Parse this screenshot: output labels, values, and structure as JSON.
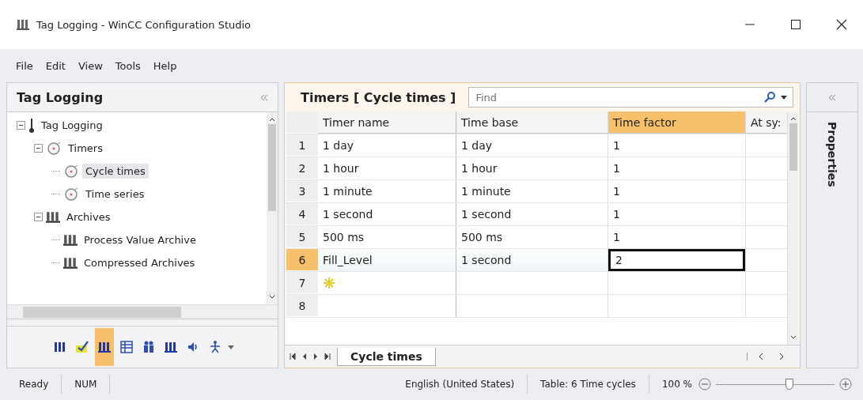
{
  "window": {
    "title": "Tag Logging - WinCC Configuration Studio"
  },
  "menu": [
    {
      "label": "File"
    },
    {
      "label": "Edit"
    },
    {
      "label": "View"
    },
    {
      "label": "Tools"
    },
    {
      "label": "Help"
    }
  ],
  "navigation": {
    "title": "Tag Logging",
    "tree": [
      {
        "label": "Tag Logging",
        "kind": "root",
        "expanded": true,
        "selected": false,
        "children": [
          {
            "label": "Timers",
            "kind": "timer",
            "expanded": true,
            "selected": false,
            "children": [
              {
                "label": "Cycle times",
                "kind": "timer",
                "selected": true
              },
              {
                "label": "Time series",
                "kind": "timer",
                "selected": false
              }
            ]
          },
          {
            "label": "Archives",
            "kind": "archive",
            "expanded": true,
            "selected": false,
            "children": [
              {
                "label": "Process Value Archive",
                "kind": "archive",
                "selected": false
              },
              {
                "label": "Compressed Archives",
                "kind": "archive",
                "selected": false
              }
            ]
          }
        ]
      }
    ],
    "toolbar": [
      {
        "kind": "bars",
        "selected": false
      },
      {
        "kind": "check",
        "selected": false
      },
      {
        "kind": "archive",
        "selected": true
      },
      {
        "kind": "table",
        "selected": false
      },
      {
        "kind": "people",
        "selected": false
      },
      {
        "kind": "archive",
        "selected": false
      },
      {
        "kind": "speaker",
        "selected": false
      },
      {
        "kind": "figure",
        "selected": false
      }
    ]
  },
  "editor": {
    "title": "Timers [ Cycle times ]",
    "search": {
      "placeholder": "Find"
    },
    "columns": [
      {
        "label": "Timer name",
        "selected": false
      },
      {
        "label": "Time base",
        "selected": false
      },
      {
        "label": "Time factor",
        "selected": true
      },
      {
        "label": "At sy:",
        "selected": false
      }
    ],
    "rows": [
      {
        "number": "1",
        "cells": [
          "1 day",
          "1 day",
          "1",
          ""
        ],
        "selected": false
      },
      {
        "number": "2",
        "cells": [
          "1 hour",
          "1 hour",
          "1",
          ""
        ],
        "selected": false
      },
      {
        "number": "3",
        "cells": [
          "1 minute",
          "1 minute",
          "1",
          ""
        ],
        "selected": false
      },
      {
        "number": "4",
        "cells": [
          "1 second",
          "1 second",
          "1",
          ""
        ],
        "selected": false
      },
      {
        "number": "5",
        "cells": [
          "500 ms",
          "500 ms",
          "1",
          ""
        ],
        "selected": false
      },
      {
        "number": "6",
        "cells": [
          "Fill_Level",
          "1 second",
          "2",
          ""
        ],
        "selected": true
      },
      {
        "number": "7",
        "kind": "new",
        "cells": [
          "",
          "",
          "",
          ""
        ],
        "selected": false
      },
      {
        "number": "8",
        "cells": [
          "",
          "",
          "",
          ""
        ],
        "selected": false
      }
    ],
    "sheet_tabs": [
      {
        "label": "Cycle times",
        "selected": true
      }
    ]
  },
  "properties": {
    "title": "Properties"
  },
  "status_bar": {
    "state": "Ready",
    "num": "NUM",
    "language": "English (United States)",
    "table_info": "Table: 6 Time cycles",
    "zoom": "100 %",
    "zoom_slider": {
      "level": 0.62
    }
  }
}
